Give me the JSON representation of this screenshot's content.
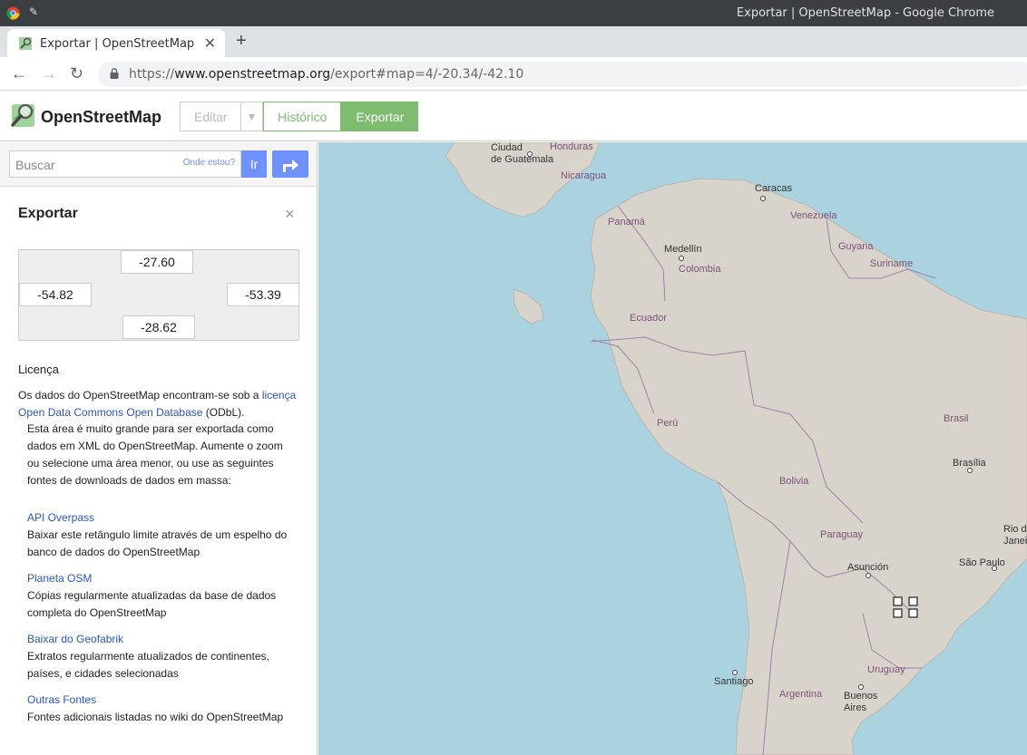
{
  "window": {
    "title": "Exportar | OpenStreetMap - Google Chrome"
  },
  "tab": {
    "title": "Exportar | OpenStreetMap",
    "close": "✕",
    "new": "+"
  },
  "address": {
    "scheme": "https://",
    "host": "www.openstreetmap.org",
    "path": "/export#map=4/-20.34/-42.10"
  },
  "header": {
    "brand": "OpenStreetMap",
    "edit": "Editar",
    "history": "Histórico",
    "export": "Exportar"
  },
  "search": {
    "placeholder": "Buscar",
    "where_am_i": "Onde estou?",
    "go": "Ir"
  },
  "panel": {
    "title": "Exportar",
    "close": "×",
    "bbox": {
      "north": "-27.60",
      "west": "-54.82",
      "east": "-53.39",
      "south": "-28.62"
    },
    "license_heading": "Licença",
    "license_text_before": "Os dados do OpenStreetMap encontram-se sob a ",
    "license_link": "licença Open Data Commons Open Database",
    "license_text_after": " (ODbL).",
    "warning": "Esta área é muito grande para ser exportada como dados em XML do OpenStreetMap. Aumente o zoom ou selecione uma área menor, ou use as seguintes fontes de downloads de dados em massa:",
    "sources": [
      {
        "link": "API Overpass",
        "desc": "Baixar este retângulo limite através de um espelho do banco de dados do OpenStreetMap"
      },
      {
        "link": "Planeta OSM",
        "desc": "Cópias regularmente atualizadas da base de dados completa do OpenStreetMap"
      },
      {
        "link": "Baixar do Geofabrik",
        "desc": "Extratos regularmente atualizados de continentes, países, e cidades selecionadas"
      },
      {
        "link": "Outras Fontes",
        "desc": "Fontes adicionais listadas no wiki do OpenStreetMap"
      }
    ]
  },
  "map": {
    "labels": {
      "guatemala": "Ciudad\nde Guatemala",
      "honduras": "Honduras",
      "nicaragua": "Nicaragua",
      "panama": "Panamá",
      "caracas": "Caracas",
      "venezuela": "Venezuela",
      "guyana": "Guyana",
      "suriname": "Suriname",
      "medellin": "Medellín",
      "colombia": "Colombia",
      "ecuador": "Ecuador",
      "peru": "Perú",
      "brasil": "Brasil",
      "brasilia": "Brasília",
      "bolivia": "Bolivia",
      "paraguay": "Paraguay",
      "asuncion": "Asunción",
      "rio": "Rio d\nJaneir",
      "saopaulo": "São Paulo",
      "uruguay": "Uruguay",
      "santiago": "Santiago",
      "argentina": "Argentina",
      "buenosaires": "Buenos\nAires"
    },
    "colors": {
      "water": "#aad3df",
      "land": "#d8d4cc",
      "border": "#8f6f9a"
    }
  }
}
